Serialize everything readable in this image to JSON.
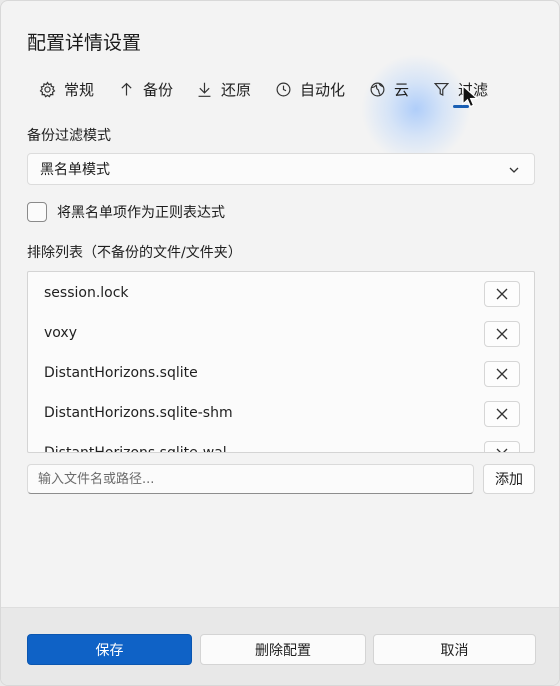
{
  "dialog": {
    "title": "配置详情设置"
  },
  "tabs": [
    {
      "label": "常规",
      "icon": "gear-icon"
    },
    {
      "label": "备份",
      "icon": "arrow-up-icon"
    },
    {
      "label": "还原",
      "icon": "arrow-down-icon"
    },
    {
      "label": "自动化",
      "icon": "clock-icon"
    },
    {
      "label": "云",
      "icon": "globe-icon"
    },
    {
      "label": "过滤",
      "icon": "filter-icon",
      "active": true
    }
  ],
  "filter": {
    "mode_label": "备份过滤模式",
    "mode_value": "黑名单模式",
    "regex_label": "将黑名单项作为正则表达式",
    "regex_checked": false,
    "exclude_label": "排除列表（不备份的文件/文件夹）",
    "items": [
      "session.lock",
      "voxy",
      "DistantHorizons.sqlite",
      "DistantHorizons.sqlite-shm",
      "DistantHorizons.sqlite-wal"
    ],
    "input_placeholder": "输入文件名或路径...",
    "add_label": "添加"
  },
  "footer": {
    "save_label": "保存",
    "delete_label": "删除配置",
    "cancel_label": "取消"
  },
  "colors": {
    "accent": "#0f62c6",
    "background": "#f3f3f3"
  }
}
